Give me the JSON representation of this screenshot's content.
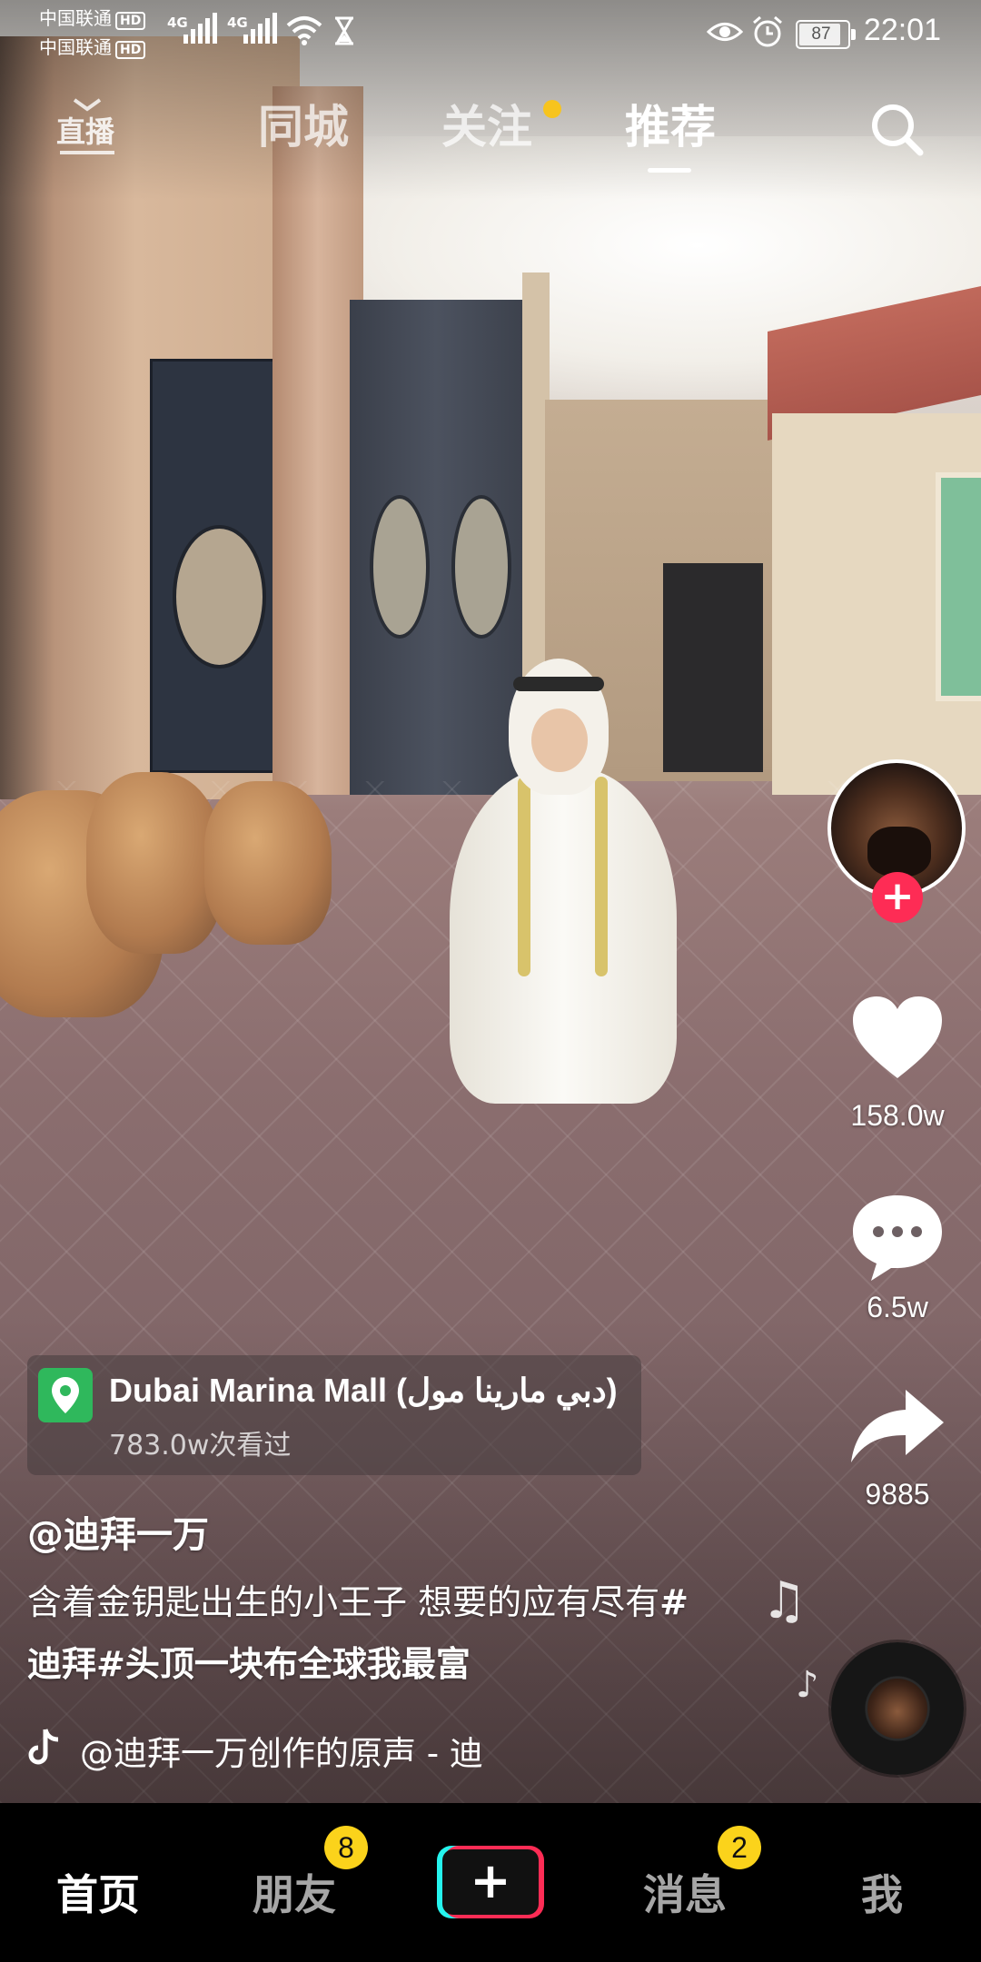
{
  "status_bar": {
    "carrier_1": "中国联通",
    "carrier_2": "中国联通",
    "hd": "HD",
    "network_1": "4G",
    "network_2": "4G",
    "battery": "87",
    "time": "22:01"
  },
  "top_nav": {
    "live_label": "直播",
    "tabs": [
      "同城",
      "关注",
      "推荐"
    ],
    "active_tab": "推荐"
  },
  "video": {
    "location": {
      "name": "Dubai Marina Mall (دبي مارينا مول)",
      "views": "783.0w次看过"
    },
    "author": "@迪拜一万",
    "caption_text": "含着金钥匙出生的小王子 想要的应有尽有",
    "hashtags": [
      "#迪拜",
      "#头顶一块布全球我最富"
    ],
    "sound": "@迪拜一万创作的原声 - 迪"
  },
  "actions": {
    "likes": "158.0w",
    "comments": "6.5w",
    "shares": "9885",
    "follow": "+"
  },
  "bottom_tabs": {
    "home": "首页",
    "friends": "朋友",
    "friends_badge": "8",
    "create": "+",
    "messages": "消息",
    "messages_badge": "2",
    "me": "我"
  },
  "colors": {
    "accent_red": "#fe2c55",
    "accent_cyan": "#25f4ee",
    "badge_yellow": "#fbd31b",
    "location_green": "#2fb85c"
  }
}
